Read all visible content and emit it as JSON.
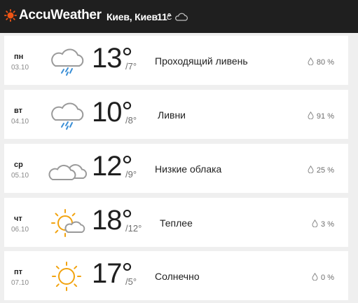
{
  "header": {
    "brand": "AccuWeather",
    "city": "Киев, Киев",
    "current_temp": "11°",
    "current_unit": "C",
    "current_icon": "cloud-icon"
  },
  "days": [
    {
      "day": "пн",
      "date": "03.10",
      "high": "13°",
      "low": "/7°",
      "phrase": "Проходящий ливень",
      "precip": "80 %",
      "icon": "rain-cloud-icon"
    },
    {
      "day": "вт",
      "date": "04.10",
      "high": "10°",
      "low": "/8°",
      "phrase": "Ливни",
      "precip": "91 %",
      "icon": "rain-cloud-icon"
    },
    {
      "day": "ср",
      "date": "05.10",
      "high": "12°",
      "low": "/9°",
      "phrase": "Низкие облака",
      "precip": "25 %",
      "icon": "clouds-icon"
    },
    {
      "day": "чт",
      "date": "06.10",
      "high": "18°",
      "low": "/12°",
      "phrase": "Теплее",
      "precip": "3 %",
      "icon": "partly-sunny-icon"
    },
    {
      "day": "пт",
      "date": "07.10",
      "high": "17°",
      "low": "/5°",
      "phrase": "Солнечно",
      "precip": "0 %",
      "icon": "sun-icon"
    }
  ],
  "colors": {
    "header_bg": "#1f1f1f",
    "accent": "#f05514",
    "sun": "#f2a30f",
    "rain": "#3b8fd6",
    "cloud": "#9a9a9a"
  }
}
